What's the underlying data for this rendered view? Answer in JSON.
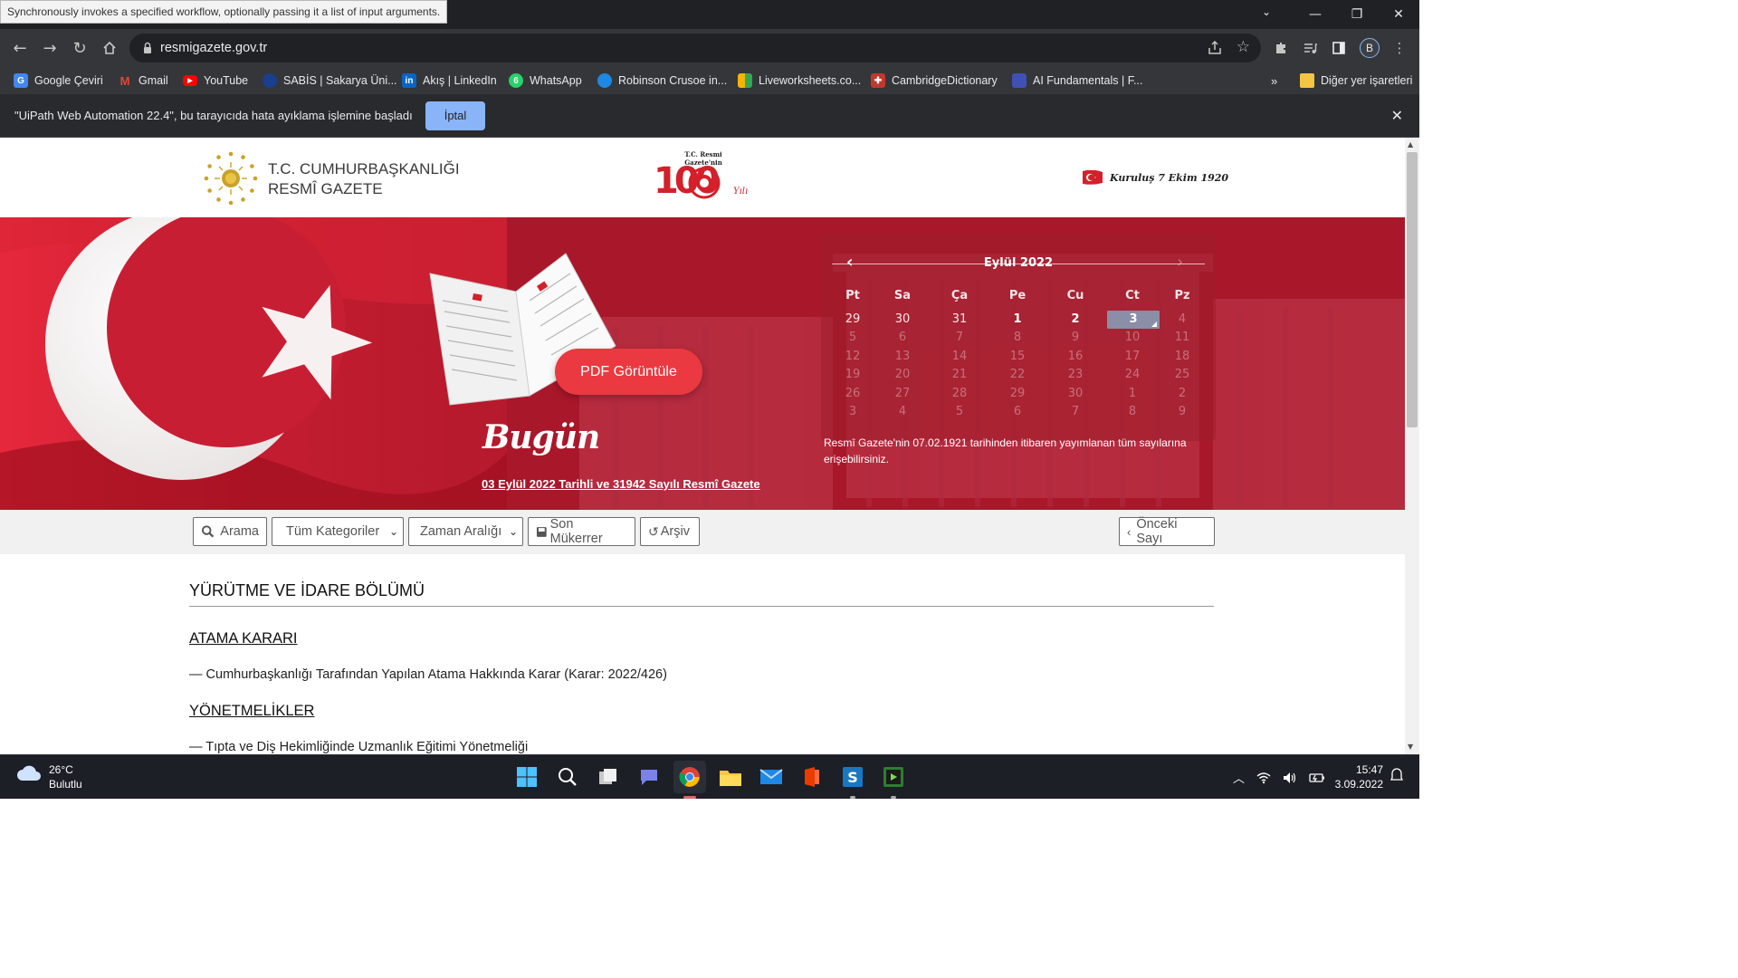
{
  "tooltip": "Synchronously invokes a specified workflow, optionally passing it a list of input arguments.",
  "browser": {
    "url": "resmigazete.gov.tr",
    "profile_initial": "B",
    "bookmarks": [
      {
        "label": "Google Çeviri",
        "icon": "google-translate-icon",
        "color": "#4285f4"
      },
      {
        "label": "Gmail",
        "icon": "gmail-icon",
        "color": "#ea4335"
      },
      {
        "label": "YouTube",
        "icon": "youtube-icon",
        "color": "#ff0000"
      },
      {
        "label": "SABİS | Sakarya Üni...",
        "icon": "sabis-icon",
        "color": "#1a3f8f"
      },
      {
        "label": "Akış | LinkedIn",
        "icon": "linkedin-icon",
        "color": "#0a66c2"
      },
      {
        "label": "WhatsApp",
        "icon": "whatsapp-icon",
        "color": "#25d366"
      },
      {
        "label": "Robinson Crusoe in...",
        "icon": "globe-icon",
        "color": "#1e88e5"
      },
      {
        "label": "Liveworksheets.co...",
        "icon": "liveworksheets-icon",
        "color": "#f4b400"
      },
      {
        "label": "CambridgeDictionary",
        "icon": "cambridge-icon",
        "color": "#c0392b"
      },
      {
        "label": "AI Fundamentals | F...",
        "icon": "ai-fundamentals-icon",
        "color": "#3f51b5"
      }
    ],
    "more_bookmarks": "»",
    "other_bookmarks": "Diğer yer işaretleri",
    "infobar_text": "\"UiPath Web Automation 22.4\", bu tarayıcıda hata ayıklama işlemine başladı",
    "infobar_button": "İptal"
  },
  "site": {
    "title_line1": "T.C. CUMHURBAŞKANLIĞI",
    "title_line2": "RESMÎ GAZETE",
    "centenary_text": "T.C. Resmi Gazete'nin",
    "centenary_number": "100",
    "centenary_suffix": "Yılı",
    "founded": "Kuruluş 7 Ekim 1920"
  },
  "hero": {
    "pdf_button": "PDF Görüntüle",
    "today": "Bugün",
    "issue_link": "03 Eylül 2022 Tarihli ve 31942 Sayılı Resmî Gazete",
    "calendar_note": "Resmî Gazete'nin 07.02.1921 tarihinden itibaren yayımlanan tüm sayılarına erişebilirsiniz."
  },
  "calendar": {
    "month": "Eylül 2022",
    "weekdays": [
      "Pt",
      "Sa",
      "Ça",
      "Pe",
      "Cu",
      "Ct",
      "Pz"
    ],
    "selected": "3",
    "weeks": [
      [
        [
          "29",
          "prev"
        ],
        [
          "30",
          "prev"
        ],
        [
          "31",
          "prev"
        ],
        [
          "1",
          "cur"
        ],
        [
          "2",
          "cur"
        ],
        [
          "3",
          "sel"
        ],
        [
          "4",
          "dim"
        ]
      ],
      [
        [
          "5",
          "dim"
        ],
        [
          "6",
          "dim"
        ],
        [
          "7",
          "dim"
        ],
        [
          "8",
          "dim"
        ],
        [
          "9",
          "dim"
        ],
        [
          "10",
          "dim"
        ],
        [
          "11",
          "dim"
        ]
      ],
      [
        [
          "12",
          "dim"
        ],
        [
          "13",
          "dim"
        ],
        [
          "14",
          "dim"
        ],
        [
          "15",
          "dim"
        ],
        [
          "16",
          "dim"
        ],
        [
          "17",
          "dim"
        ],
        [
          "18",
          "dim"
        ]
      ],
      [
        [
          "19",
          "dim"
        ],
        [
          "20",
          "dim"
        ],
        [
          "21",
          "dim"
        ],
        [
          "22",
          "dim"
        ],
        [
          "23",
          "dim"
        ],
        [
          "24",
          "dim"
        ],
        [
          "25",
          "dim"
        ]
      ],
      [
        [
          "26",
          "dim"
        ],
        [
          "27",
          "dim"
        ],
        [
          "28",
          "dim"
        ],
        [
          "29",
          "dim"
        ],
        [
          "30",
          "dim"
        ],
        [
          "1",
          "dim"
        ],
        [
          "2",
          "dim"
        ]
      ],
      [
        [
          "3",
          "dim"
        ],
        [
          "4",
          "dim"
        ],
        [
          "5",
          "dim"
        ],
        [
          "6",
          "dim"
        ],
        [
          "7",
          "dim"
        ],
        [
          "8",
          "dim"
        ],
        [
          "9",
          "dim"
        ]
      ]
    ]
  },
  "filters": {
    "search": "Arama",
    "categories": "Tüm Kategoriler",
    "date_range": "Zaman Aralığı",
    "repeat": "Son Mükerrer",
    "archive": "Arşiv",
    "previous": "Önceki Sayı"
  },
  "content": {
    "section": "YÜRÜTME VE İDARE BÖLÜMÜ",
    "sub1": "ATAMA KARARI",
    "item1": "— Cumhurbaşkanlığı Tarafından Yapılan Atama Hakkında Karar (Karar: 2022/426)",
    "sub2": "YÖNETMELİKLER",
    "item2": "— Tıpta ve Diş Hekimliğinde Uzmanlık Eğitimi Yönetmeliği"
  },
  "taskbar": {
    "temperature": "26°C",
    "weather": "Bulutlu",
    "time": "15:47",
    "date": "3.09.2022"
  },
  "colors": {
    "hero_red": "#b71b2c",
    "pdf_button": "#ea3940",
    "calendar_selected": "#8a8ea6",
    "infobar_button": "#8ab4f8"
  }
}
